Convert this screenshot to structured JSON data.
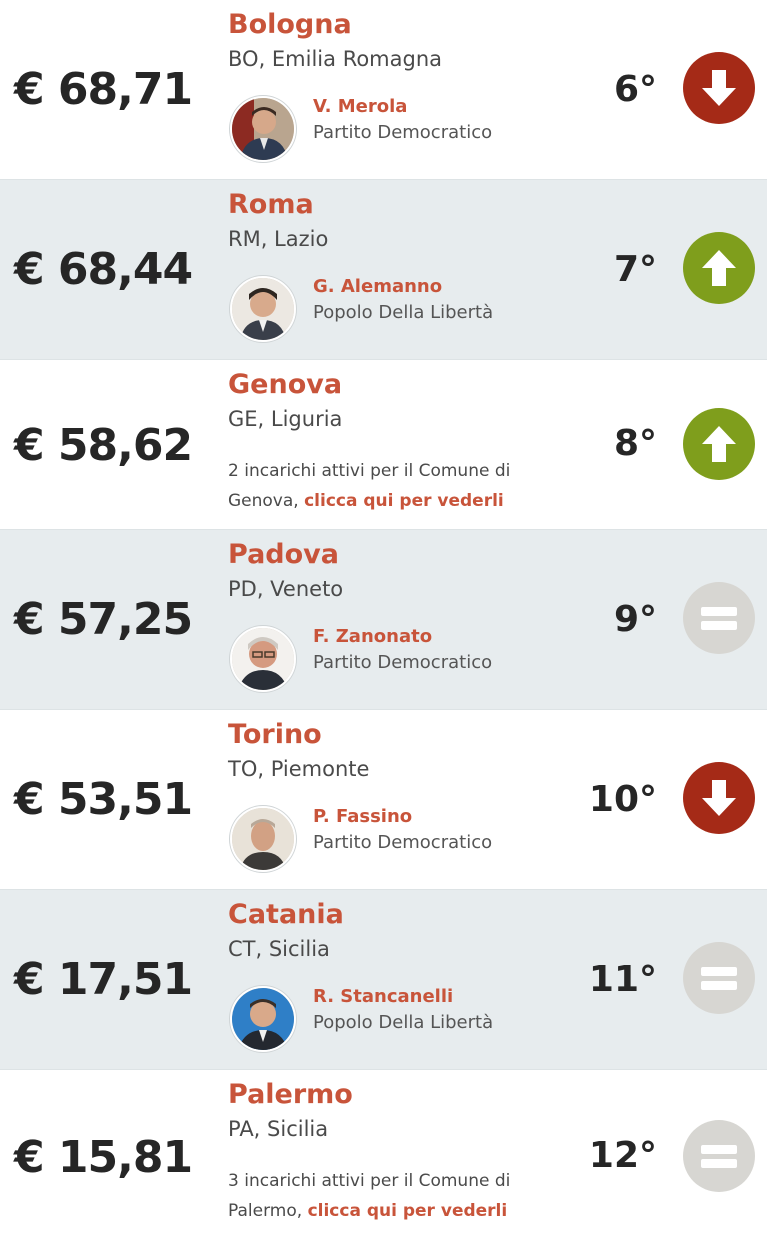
{
  "colors": {
    "down": "#a52a17",
    "up": "#7f9e1c",
    "same": "#d7d6d2",
    "accent": "#c8543a"
  },
  "rows": [
    {
      "amount": "€ 68,71",
      "city": "Bologna",
      "region": "BO, Emilia Romagna",
      "mayor": "V. Merola",
      "party": "Partito Democratico",
      "rank": "6°",
      "trend": "down",
      "trend_icon": "arrow-down-icon"
    },
    {
      "amount": "€ 68,44",
      "city": "Roma",
      "region": "RM, Lazio",
      "mayor": "G. Alemanno",
      "party": "Popolo Della Libertà",
      "rank": "7°",
      "trend": "up",
      "trend_icon": "arrow-up-icon"
    },
    {
      "amount": "€ 58,62",
      "city": "Genova",
      "region": "GE, Liguria",
      "note_text": "2 incarichi attivi per il Comune di Genova,",
      "note_link": "clicca qui per vederli",
      "rank": "8°",
      "trend": "up",
      "trend_icon": "arrow-up-icon"
    },
    {
      "amount": "€ 57,25",
      "city": "Padova",
      "region": "PD, Veneto",
      "mayor": "F. Zanonato",
      "party": "Partito Democratico",
      "rank": "9°",
      "trend": "same",
      "trend_icon": "equals-icon"
    },
    {
      "amount": "€ 53,51",
      "city": "Torino",
      "region": "TO, Piemonte",
      "mayor": "P. Fassino",
      "party": "Partito Democratico",
      "rank": "10°",
      "trend": "down",
      "trend_icon": "arrow-down-icon"
    },
    {
      "amount": "€ 17,51",
      "city": "Catania",
      "region": "CT, Sicilia",
      "mayor": "R. Stancanelli",
      "party": "Popolo Della Libertà",
      "rank": "11°",
      "trend": "same",
      "trend_icon": "equals-icon"
    },
    {
      "amount": "€ 15,81",
      "city": "Palermo",
      "region": "PA, Sicilia",
      "note_text": "3 incarichi attivi per il Comune di Palermo,",
      "note_link": "clicca qui per vederli",
      "rank": "12°",
      "trend": "same",
      "trend_icon": "equals-icon"
    }
  ]
}
